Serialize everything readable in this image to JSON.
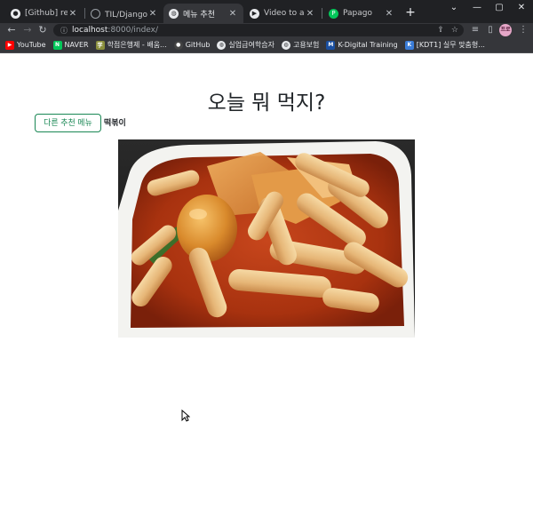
{
  "browser": {
    "tabs": [
      {
        "title": "[Github] readme!",
        "icon": "github-icon",
        "active": false
      },
      {
        "title": "TIL/Django/실습",
        "icon": "github-icon",
        "active": false
      },
      {
        "title": "메뉴 추천",
        "icon": "globe-icon",
        "active": true
      },
      {
        "title": "Video to animate",
        "icon": "video-icon",
        "active": false
      },
      {
        "title": "Papago",
        "icon": "papago-icon",
        "active": false
      }
    ],
    "new_tab": "+",
    "window_controls": {
      "dropdown": "⌄",
      "minimize": "—",
      "maximize": "▢",
      "close": "✕"
    },
    "address": {
      "host": "localhost",
      "path": ":8000/index/"
    },
    "avatar_text": "프로",
    "bookmarks": [
      {
        "label": "YouTube",
        "icon": "youtube-icon",
        "color": "#ff0000"
      },
      {
        "label": "NAVER",
        "icon": "naver-icon",
        "color": "#03c75a"
      },
      {
        "label": "학점은행제 - 배움...",
        "icon": "bank-icon",
        "color": "#8a8f3c"
      },
      {
        "label": "GitHub",
        "icon": "github-icon",
        "color": "#444"
      },
      {
        "label": "실업급여학습자",
        "icon": "globe-icon",
        "color": "#5f6368"
      },
      {
        "label": "고용보험",
        "icon": "globe-icon",
        "color": "#5f6368"
      },
      {
        "label": "K-Digital Training",
        "icon": "m-icon",
        "color": "#1a4fa0"
      },
      {
        "label": "[KDT1] 실무 맞춤형...",
        "icon": "kdt-icon",
        "color": "#3b7dd8"
      }
    ]
  },
  "page": {
    "heading": "오늘 뭐 먹지?",
    "recommend_button": "다른 추천 메뉴",
    "menu_name": "떡볶이",
    "image_alt": "떡볶이"
  }
}
